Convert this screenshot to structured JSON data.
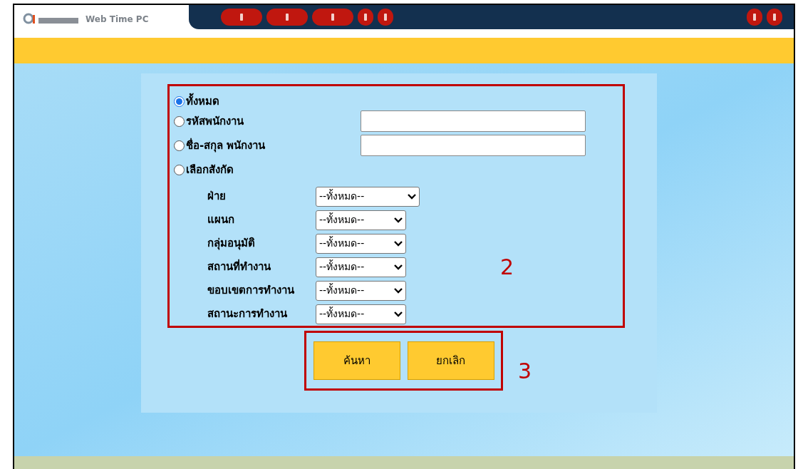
{
  "header": {
    "app_title": "Web Time PC"
  },
  "filter": {
    "options": [
      {
        "label": "ทั้งหมด",
        "selected": true,
        "kind": "plain"
      },
      {
        "label": "รหัสพนักงาน",
        "selected": false,
        "kind": "text"
      },
      {
        "label": "ชื่อ-สกุล พนักงาน",
        "selected": false,
        "kind": "text"
      },
      {
        "label": "เลือกสังกัด",
        "selected": false,
        "kind": "plain"
      }
    ],
    "selects": [
      {
        "label": "ฝ่าย",
        "value": "--ทั้งหมด--",
        "wide": true
      },
      {
        "label": "แผนก",
        "value": "--ทั้งหมด--",
        "wide": false
      },
      {
        "label": "กลุ่มอนุมัติ",
        "value": "--ทั้งหมด--",
        "wide": false
      },
      {
        "label": "สถานที่ทำงาน",
        "value": "--ทั้งหมด--",
        "wide": false
      },
      {
        "label": "ขอบเขตการทำงาน",
        "value": "--ทั้งหมด--",
        "wide": false
      },
      {
        "label": "สถานะการทำงาน",
        "value": "--ทั้งหมด--",
        "wide": false
      }
    ],
    "callout": "2"
  },
  "buttons": {
    "items": [
      "ค้นหา",
      "ยกเลิก"
    ],
    "callout": "3"
  }
}
